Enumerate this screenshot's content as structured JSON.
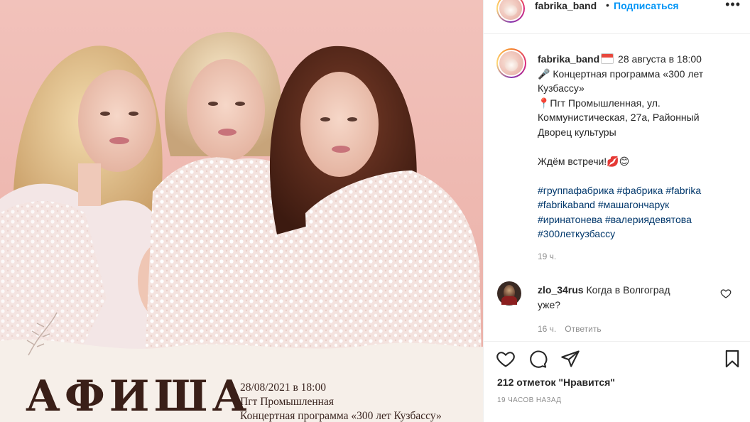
{
  "colors": {
    "link_blue": "#0095f6",
    "hashtag": "#00376b",
    "muted": "#8e8e8e",
    "text": "#262626",
    "poster_background": "#efbcb4"
  },
  "poster": {
    "title": "АФИША",
    "lines": [
      "28/08/2021 в 18:00",
      "Пгт Промышленная",
      "Концертная программа «300 лет Кузбассу»"
    ]
  },
  "header": {
    "username": "fabrika_band",
    "dot": "•",
    "follow_label": "Подписаться",
    "more_icon": "ellipsis-icon"
  },
  "caption": {
    "username": "fabrika_band",
    "line1_rest": "28 августа в 18:00",
    "line2": "🎤 Концертная программа «300 лет",
    "line3": "Кузбассу»",
    "line4": "📍Пгт Промышленная, ул.",
    "line5": "Коммунистическая, 27а, Районный",
    "line6": "Дворец культуры",
    "line7": "Ждём встречи!💋😊",
    "hashtags": [
      "#группафабрика #фабрика #fabrika",
      "#fabrikaband #машагончарук",
      "#иринатонева #валериядевятова",
      "#300леткузбассу"
    ],
    "time": "19 ч."
  },
  "comment": {
    "username": "zlo_34rus",
    "text_line1": "Когда в Волгоград",
    "text_line2": "уже?",
    "time": "16 ч.",
    "reply_label": "Ответить"
  },
  "actions": {
    "icons": [
      "heart-icon",
      "comment-icon",
      "share-icon",
      "bookmark-icon"
    ],
    "likes_text": "212 отметок \"Нравится\"",
    "posted_ago": "19 часов назад"
  }
}
